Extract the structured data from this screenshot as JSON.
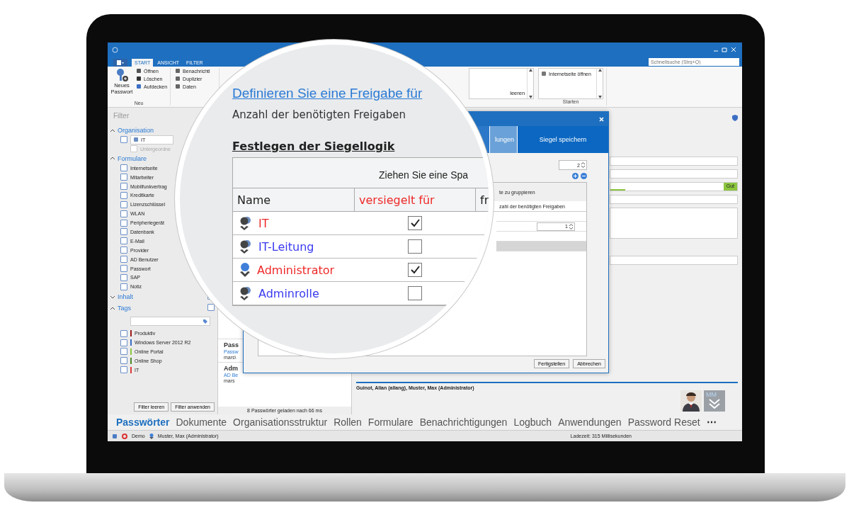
{
  "window": {
    "tabs": [
      {
        "label": "START",
        "selected": true
      },
      {
        "label": "ANSICHT",
        "selected": false
      },
      {
        "label": "FILTER",
        "selected": false
      }
    ],
    "quick_search": {
      "placeholder": "Schnellsuche (Strg+Q)"
    }
  },
  "ribbon": {
    "new_group": {
      "title": "Neu",
      "large_button": "Neues Passwort",
      "items": [
        "Öffnen",
        "Löschen",
        "Aufdecken"
      ]
    },
    "cut_group": {
      "items": [
        "Benachrichti",
        "Duplizier",
        "Daten"
      ]
    },
    "list_box": {
      "items": [
        "leeren"
      ]
    },
    "launch_group": {
      "title": "Starten",
      "items": [
        "Internetseite öffnen"
      ]
    }
  },
  "filter": {
    "title": "Filter",
    "organisation": {
      "label": "Organisation",
      "expanded": true,
      "value": "IT",
      "checked": false,
      "sub_option": {
        "label": "Untergeordne",
        "checked": false
      }
    },
    "forms": {
      "label": "Formulare",
      "expanded": true,
      "items": [
        {
          "label": "Internetseite",
          "checked": false
        },
        {
          "label": "Mitarbeiter",
          "checked": false
        },
        {
          "label": "Mobilfunkvertrag",
          "checked": false
        },
        {
          "label": "Kreditkarte",
          "checked": false
        },
        {
          "label": "Lizenzschlüssel",
          "checked": false
        },
        {
          "label": "WLAN",
          "checked": false
        },
        {
          "label": "Peripheriegerät",
          "checked": false
        },
        {
          "label": "Datenbank",
          "checked": false
        },
        {
          "label": "E-Mail",
          "checked": false
        },
        {
          "label": "Provider",
          "checked": false
        },
        {
          "label": "AD Benutzer",
          "checked": false
        },
        {
          "label": "Passwort",
          "checked": false
        },
        {
          "label": "SAP",
          "checked": false
        },
        {
          "label": "Notiz",
          "checked": false
        }
      ]
    },
    "content": {
      "label": "Inhalt",
      "expanded": false,
      "checked": false
    },
    "tags": {
      "label": "Tags",
      "expanded": true,
      "checked": false,
      "items": [
        {
          "label": "Produktiv",
          "checked": false,
          "color": "#9b1c1c"
        },
        {
          "label": "Windows Server 2012 R2",
          "checked": false,
          "color": "#3b6fc4"
        },
        {
          "label": "Online Portal",
          "checked": false,
          "color": "#8cc63f"
        },
        {
          "label": "Online Shop",
          "checked": false,
          "color": "#4e8a2a"
        },
        {
          "label": "IT",
          "checked": false,
          "color": "#d93a3a"
        }
      ]
    },
    "buttons": [
      "Filter leeren",
      "Filter anwenden"
    ]
  },
  "list": {
    "entries": [
      {
        "title": "Pass",
        "subtitle": "Passw",
        "user": "mars\\"
      },
      {
        "title": "Adm",
        "subtitle": "AD Be",
        "user": "mars"
      }
    ],
    "footer": "8 Passwörter geladen nach 66 ms"
  },
  "detail": {
    "strength": {
      "label": "Gut",
      "level": 0.13
    },
    "owners": "Guinot, Allan (allang), Muster, Max (Administrator)",
    "avatars": [
      {
        "kind": "picture"
      },
      {
        "kind": "initials",
        "text": "MM"
      }
    ]
  },
  "dialog": {
    "tabs": [
      {
        "label": "lungen",
        "selected": false
      },
      {
        "label": "Siegel speichern",
        "selected": true
      }
    ],
    "required_count": "2",
    "group_hint": "te zu gruppieren",
    "column": "zahl der benötigten Freigaben",
    "row_value": "1",
    "rows": [
      {
        "selected": false
      },
      {
        "selected": false
      },
      {
        "selected": false
      },
      {
        "selected": true
      }
    ],
    "buttons": [
      "Fertigstellen",
      "Abbrechen"
    ]
  },
  "magnifier": {
    "heading": "Definieren Sie eine Freigabe für",
    "subheading": "Anzahl der benötigten Freigaben",
    "section": "Festlegen der Siegellogik",
    "drag_hint": "Ziehen Sie eine Spa",
    "columns": [
      "Name",
      "versiegelt für",
      "fr"
    ],
    "rows": [
      {
        "kind": "role",
        "name": "IT",
        "color": "#ee2a2a",
        "checked": true
      },
      {
        "kind": "role",
        "name": "IT-Leitung",
        "color": "#3a3af0",
        "checked": false
      },
      {
        "kind": "user",
        "name": "Administrator",
        "color": "#ee2a2a",
        "checked": true
      },
      {
        "kind": "role",
        "name": "Adminrolle",
        "color": "#3a3af0",
        "checked": false
      }
    ]
  },
  "navigation": {
    "items": [
      {
        "label": "Passwörter",
        "selected": true
      },
      {
        "label": "Dokumente",
        "selected": false
      },
      {
        "label": "Organisationsstruktur",
        "selected": false
      },
      {
        "label": "Rollen",
        "selected": false
      },
      {
        "label": "Formulare",
        "selected": false
      },
      {
        "label": "Benachrichtigungen",
        "selected": false
      },
      {
        "label": "Logbuch",
        "selected": false
      },
      {
        "label": "Anwendungen",
        "selected": false
      },
      {
        "label": "Password Reset",
        "selected": false
      }
    ],
    "more": "⋯"
  },
  "status_bar": {
    "database": "Demo",
    "user": "Muster, Max (Administrator)",
    "load_time": "Ladezeit: 315 Millisekunden"
  }
}
